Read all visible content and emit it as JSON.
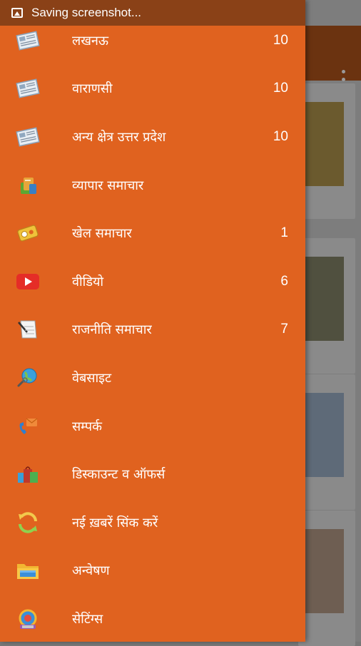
{
  "status_bar": {
    "text": "Saving screenshot..."
  },
  "colors": {
    "drawer": "#e0621f",
    "status_bar": "#8a4117",
    "toolbar": "#6b3310"
  },
  "menu": [
    {
      "label": "लखनऊ",
      "count": "10",
      "icon": "newspaper-icon"
    },
    {
      "label": "वाराणसी",
      "count": "10",
      "icon": "newspaper-icon"
    },
    {
      "label": "अन्य क्षेत्र उत्तर प्रदेश",
      "count": "10",
      "icon": "newspaper-icon"
    },
    {
      "label": "व्यापार समाचार",
      "count": "",
      "icon": "business-icon"
    },
    {
      "label": "खेल समाचार",
      "count": "1",
      "icon": "sports-icon"
    },
    {
      "label": "वीडियो",
      "count": "6",
      "icon": "youtube-icon"
    },
    {
      "label": "राजनीति समाचार",
      "count": "7",
      "icon": "politics-icon"
    },
    {
      "label": "वेबसाइट",
      "count": "",
      "icon": "globe-search-icon"
    },
    {
      "label": "सम्पर्क",
      "count": "",
      "icon": "contact-icon"
    },
    {
      "label": "डिस्काउन्ट व ऑफर्स",
      "count": "",
      "icon": "shopping-bags-icon"
    },
    {
      "label": "नई ख़बरें सिंक करें",
      "count": "",
      "icon": "sync-icon"
    },
    {
      "label": "अन्वेषण",
      "count": "",
      "icon": "folder-search-icon"
    },
    {
      "label": "सेटिंग्स",
      "count": "",
      "icon": "settings-icon"
    }
  ]
}
